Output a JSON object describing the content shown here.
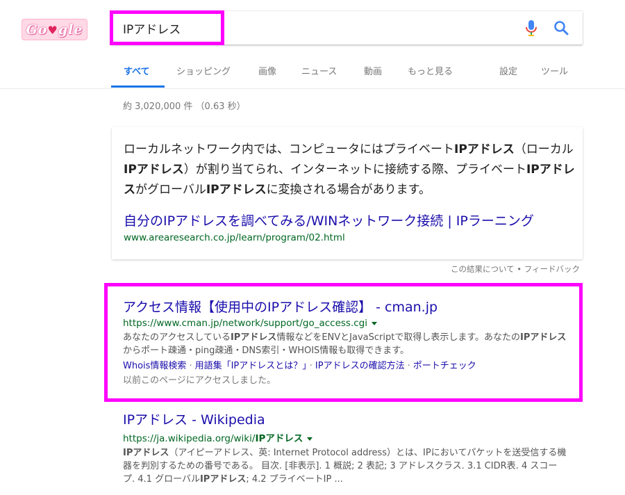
{
  "logo": {
    "prefix": "Go",
    "heart": "♥",
    "suffix": "gle"
  },
  "search": {
    "query": "IPアドレス"
  },
  "icons": {
    "mic": "microphone-icon",
    "search": "search-icon",
    "caret": "dropdown-caret-icon"
  },
  "tabs": [
    {
      "label": "すべて"
    },
    {
      "label": "ショッピング"
    },
    {
      "label": "画像"
    },
    {
      "label": "ニュース"
    },
    {
      "label": "動画"
    },
    {
      "label": "もっと見る"
    },
    {
      "label": "設定"
    },
    {
      "label": "ツール"
    }
  ],
  "stats": "約 3,020,000 件 （0.63 秒）",
  "snippet": {
    "parts": [
      "ローカルネットワーク内では、コンピュータにはプライベート",
      "IPアドレス",
      "（ローカル",
      "IPアドレス",
      "）が割り当てられ、インターネットに接続する際、プライベート",
      "IPアドレス",
      "がグローバル",
      "IPアドレス",
      "に変換される場合があります。"
    ],
    "link": "自分のIPアドレスを調べてみる/WINネットワーク接続 | IPラーニング",
    "url": "www.arearesearch.co.jp/learn/program/02.html"
  },
  "feedback": "この結果について • フィードバック",
  "results": [
    {
      "title": "アクセス情報【使用中のIPアドレス確認】 - cman.jp",
      "url": "https://www.cman.jp/network/support/go_access.cgi",
      "desc_parts": [
        "あなたのアクセスしている",
        "IPアドレス",
        "情報などをENVとJavaScriptで取得し表示します。あなたの",
        "IPアドレス",
        "からポート疎通・ping疎通・DNS索引・WHOIS情報も取得できます。"
      ],
      "sitelinks": [
        "Whois情報検索",
        "用語集「IPアドレスとは？」",
        "IPアドレスの確認方法",
        "ポートチェック"
      ],
      "sitelink_sep": "·",
      "visited": "以前このページにアクセスしました。"
    },
    {
      "title": "IPアドレス - Wikipedia",
      "url_prefix": "https://ja.wikipedia.org/wiki/",
      "url_bold": "IPアドレス",
      "desc_parts": [
        "IPアドレス",
        "（アイピーアドレス、英: Internet Protocol address）とは、IPにおいてパケットを送受信する機器を判別するための番号である。 目次. [非表示]. 1 概説; 2 表記; 3 アドレスクラス. 3.1 CIDR表. 4 スコープ. 4.1 グローバル",
        "IPアドレス",
        "; 4.2 プライベートIP ..."
      ]
    }
  ],
  "colors": {
    "highlight": "#ff00ff",
    "link": "#1a0dab",
    "url": "#006621",
    "tab_active": "#1a73e8"
  }
}
